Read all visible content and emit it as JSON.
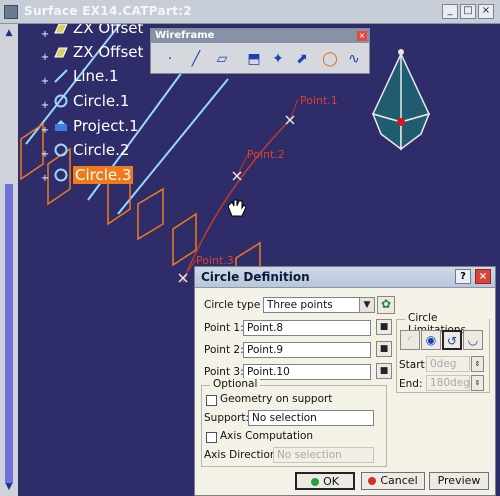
{
  "window": {
    "title": "Surface EX14.CATPart:2",
    "buttons": {
      "minimize": "_",
      "maximize": "□",
      "close": "×"
    }
  },
  "scrollbar": {
    "up_arrow": "▲",
    "down_arrow": "▼"
  },
  "tree": {
    "items": [
      {
        "label": "ZX Offset",
        "icon": "plane-icon",
        "selected": false
      },
      {
        "label": "ZX Offset",
        "icon": "plane-icon",
        "selected": false
      },
      {
        "label": "Line.1",
        "icon": "line-icon",
        "selected": false
      },
      {
        "label": "Circle.1",
        "icon": "circle-icon",
        "selected": false
      },
      {
        "label": "Project.1",
        "icon": "project-icon",
        "selected": false
      },
      {
        "label": "Circle.2",
        "icon": "circle-icon",
        "selected": false
      },
      {
        "label": "Circle.3",
        "icon": "circle-icon",
        "selected": true
      }
    ]
  },
  "toolbar": {
    "title": "Wireframe",
    "close": "×",
    "buttons": [
      "point-icon",
      "line-icon",
      "plane-icon",
      "projection-icon",
      "intersection-icon",
      "circle-icon",
      "spline-icon"
    ]
  },
  "viewport_labels": {
    "point1": "Point.1",
    "point2": "Point.2",
    "point3": "Point.3"
  },
  "dialog": {
    "title": "Circle Definition",
    "help": "?",
    "close": "×",
    "circle_type_label": "Circle type :",
    "circle_type_value": "Three points",
    "point1_label": "Point 1:",
    "point1_value": "Point.8",
    "point2_label": "Point 2:",
    "point2_value": "Point.9",
    "point3_label": "Point 3:",
    "point3_value": "Point.10",
    "optional_label": "Optional",
    "geometry_on_support": "Geometry on support",
    "support_label": "Support:",
    "support_value": "No selection",
    "axis_computation": "Axis Computation",
    "axis_direction_label": "Axis Direction:",
    "axis_direction_value": "No selection",
    "limitations_label": "Circle Limitations",
    "start_label": "Start:",
    "start_value": "0deg",
    "end_label": "End:",
    "end_value": "180deg",
    "ok": "OK",
    "cancel": "Cancel",
    "preview": "Preview"
  },
  "colors": {
    "background": "#2e2c69",
    "selection": "#f07a1c",
    "wire_cyan": "#9ad7ff",
    "arc_red": "#c0392b",
    "compass": "#1f5c6f"
  }
}
